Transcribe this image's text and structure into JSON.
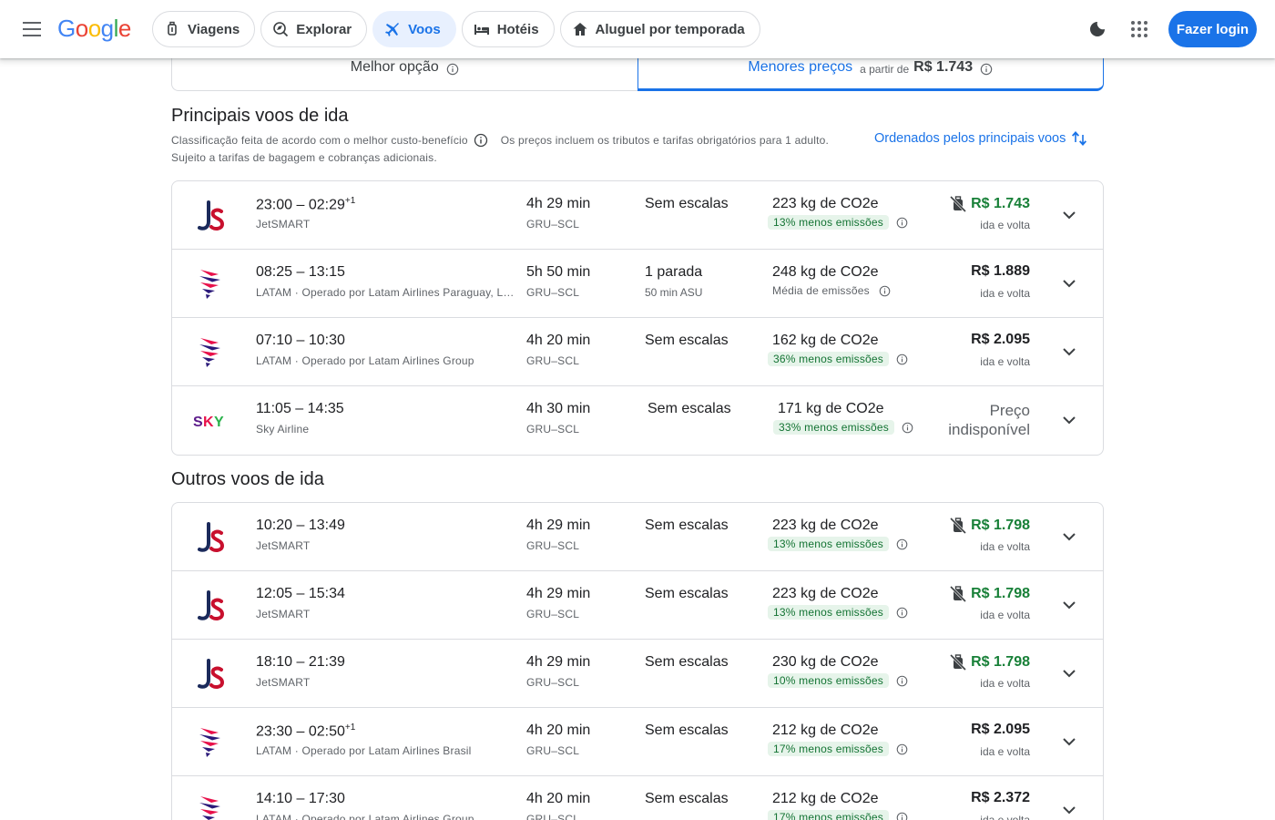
{
  "header": {
    "logo": [
      "G",
      "o",
      "o",
      "g",
      "l",
      "e"
    ],
    "logo_colors": [
      "#4285F4",
      "#EA4335",
      "#FBBC05",
      "#4285F4",
      "#34A853",
      "#EA4335"
    ],
    "nav": [
      {
        "label": "Viagens",
        "icon": "luggage-icon"
      },
      {
        "label": "Explorar",
        "icon": "explore-icon"
      },
      {
        "label": "Voos",
        "icon": "airplane-icon",
        "active": true
      },
      {
        "label": "Hotéis",
        "icon": "bed-icon"
      },
      {
        "label": "Aluguel por temporada",
        "icon": "house-icon"
      }
    ],
    "login_label": "Fazer login"
  },
  "sort_tabs": {
    "best_label": "Melhor opção",
    "cheap_label": "Menores preços",
    "cheap_from": "a partir de",
    "cheap_price": "R$ 1.743"
  },
  "top_section": {
    "title": "Principais voos de ida",
    "ranking_note": "Classificação feita de acordo com o melhor custo-benefício",
    "tax_note": "Os preços incluem os tributos e tarifas obrigatórios para 1 adulto.",
    "baggage_note": "Sujeito a tarifas de bagagem e cobranças adicionais.",
    "sort_order": "Ordenados pelos principais voos"
  },
  "other_section": {
    "title": "Outros voos de ida"
  },
  "top_flights": [
    {
      "logo": "jetsmart",
      "times": "23:00 – 02:29",
      "plus": "+1",
      "carrier": "JetSMART",
      "duration": "4h 29 min",
      "route": "GRU–SCL",
      "stops": "Sem escalas",
      "stops_sub": "",
      "co2": "223 kg de CO2e",
      "emissions": "13% menos emissões",
      "emis_type": "low",
      "price": "R$ 1.743",
      "price_color": "green",
      "no_bag": true,
      "price_sub": "ida e volta"
    },
    {
      "logo": "latam",
      "times": "08:25 – 13:15",
      "plus": "",
      "carrier": "LATAM · Operado por Latam Airlines Paraguay, Latam Airlines Brasil",
      "duration": "5h 50 min",
      "route": "GRU–SCL",
      "stops": "1 parada",
      "stops_sub": "50 min ASU",
      "co2": "248 kg de CO2e",
      "emissions": "Média de emissões",
      "emis_type": "avg",
      "price": "R$ 1.889",
      "price_color": "",
      "no_bag": false,
      "price_sub": "ida e volta"
    },
    {
      "logo": "latam",
      "times": "07:10 – 10:30",
      "plus": "",
      "carrier": "LATAM · Operado por Latam Airlines Group",
      "duration": "4h 20 min",
      "route": "GRU–SCL",
      "stops": "Sem escalas",
      "stops_sub": "",
      "co2": "162 kg de CO2e",
      "emissions": "36% menos emissões",
      "emis_type": "low",
      "price": "R$ 2.095",
      "price_color": "",
      "no_bag": false,
      "price_sub": "ida e volta"
    },
    {
      "logo": "sky",
      "times": "11:05 – 14:35",
      "plus": "",
      "carrier": "Sky Airline",
      "duration": "4h 30 min",
      "route": "GRU–SCL",
      "stops": "Sem escalas",
      "stops_sub": "",
      "co2": "171 kg de CO2e",
      "emissions": "33% menos emissões",
      "emis_type": "low",
      "price": "",
      "price_na": [
        "Preço",
        "indisponível"
      ],
      "price_color": "",
      "no_bag": false,
      "price_sub": ""
    }
  ],
  "other_flights": [
    {
      "logo": "jetsmart",
      "times": "10:20 – 13:49",
      "plus": "",
      "carrier": "JetSMART",
      "duration": "4h 29 min",
      "route": "GRU–SCL",
      "stops": "Sem escalas",
      "stops_sub": "",
      "co2": "223 kg de CO2e",
      "emissions": "13% menos emissões",
      "emis_type": "low",
      "price": "R$ 1.798",
      "price_color": "green",
      "no_bag": true,
      "price_sub": "ida e volta"
    },
    {
      "logo": "jetsmart",
      "times": "12:05 – 15:34",
      "plus": "",
      "carrier": "JetSMART",
      "duration": "4h 29 min",
      "route": "GRU–SCL",
      "stops": "Sem escalas",
      "stops_sub": "",
      "co2": "223 kg de CO2e",
      "emissions": "13% menos emissões",
      "emis_type": "low",
      "price": "R$ 1.798",
      "price_color": "green",
      "no_bag": true,
      "price_sub": "ida e volta"
    },
    {
      "logo": "jetsmart",
      "times": "18:10 – 21:39",
      "plus": "",
      "carrier": "JetSMART",
      "duration": "4h 29 min",
      "route": "GRU–SCL",
      "stops": "Sem escalas",
      "stops_sub": "",
      "co2": "230 kg de CO2e",
      "emissions": "10% menos emissões",
      "emis_type": "low",
      "price": "R$ 1.798",
      "price_color": "green",
      "no_bag": true,
      "price_sub": "ida e volta"
    },
    {
      "logo": "latam",
      "times": "23:30 – 02:50",
      "plus": "+1",
      "carrier": "LATAM · Operado por Latam Airlines Brasil",
      "duration": "4h 20 min",
      "route": "GRU–SCL",
      "stops": "Sem escalas",
      "stops_sub": "",
      "co2": "212 kg de CO2e",
      "emissions": "17% menos emissões",
      "emis_type": "low",
      "price": "R$ 2.095",
      "price_color": "",
      "no_bag": false,
      "price_sub": "ida e volta"
    },
    {
      "logo": "latam",
      "times": "14:10 – 17:30",
      "plus": "",
      "carrier": "LATAM · Operado por Latam Airlines Group",
      "duration": "4h 20 min",
      "route": "GRU–SCL",
      "stops": "Sem escalas",
      "stops_sub": "",
      "co2": "212 kg de CO2e",
      "emissions": "17% menos emissões",
      "emis_type": "low",
      "price": "R$ 2.372",
      "price_color": "",
      "no_bag": false,
      "price_sub": "ida e volta"
    }
  ],
  "colors": {
    "accent": "#1a73e8",
    "green_price": "#188038",
    "jetsmart_navy": "#1b2a5b",
    "jetsmart_red": "#c8102e",
    "latam_indigo": "#2b1a7a",
    "latam_coral": "#e8114b",
    "sky_purple": "#5b1a8a"
  }
}
